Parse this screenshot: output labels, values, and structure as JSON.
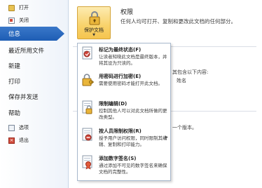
{
  "nav": {
    "open": {
      "label": "打开",
      "icon": "folder-icon"
    },
    "close": {
      "label": "关闭",
      "icon": "close-document-icon"
    },
    "info": {
      "label": "信息"
    },
    "recent": {
      "label": "最近所用文件"
    },
    "new": {
      "label": "新建"
    },
    "print": {
      "label": "打印"
    },
    "save_send": {
      "label": "保存并发送"
    },
    "help": {
      "label": "帮助"
    },
    "options": {
      "label": "选项",
      "icon": "options-icon"
    },
    "exit": {
      "label": "退出",
      "icon": "exit-icon"
    }
  },
  "permissions": {
    "button_label": "保护文档",
    "title": "权限",
    "description": "任何人均可打开、复制和更改此文档的任何部分。"
  },
  "background": {
    "line1": "其包含以下内容:",
    "line2": "姓名",
    "line3": "一个版本。"
  },
  "menu": {
    "items": [
      {
        "title": "标记为最终状态(F)",
        "desc": "让读者知晓此文档是最终版本，并将其设为只读的。",
        "icon": "mark-final-icon"
      },
      {
        "title": "用密码进行加密(E)",
        "desc": "需要使用密码才能打开此文档。",
        "icon": "encrypt-key-icon"
      },
      {
        "title": "限制编辑(D)",
        "desc": "控制其他人可以对此文档所做的更改类型。",
        "icon": "restrict-editing-icon"
      },
      {
        "title": "按人员限制权限(R)",
        "desc": "授予用户访问权限，同时限制其编辑、复制和打印能力。",
        "icon": "restrict-permission-icon",
        "has_submenu": true
      },
      {
        "title": "添加数字签名(S)",
        "desc": "通过添加不可见的数字签名来确保文档的完整性。",
        "icon": "digital-signature-icon"
      }
    ]
  },
  "colors": {
    "accent": "#1e5db4",
    "highlight": "#f8d26a"
  }
}
